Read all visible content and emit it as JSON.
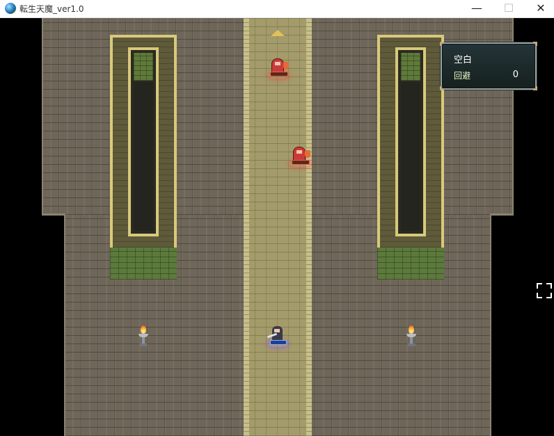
{
  "window": {
    "title": "転生天魔_ver1.0",
    "icon": "globe-icon",
    "controls": {
      "minimize": "—",
      "maximize": "☐",
      "close": "✕"
    }
  },
  "status_window": {
    "name": "空白",
    "evade_label": "回避",
    "evade_value": "0"
  },
  "colors": {
    "floor": "#6e6658",
    "carpet": "#a49b6a",
    "pillar_trim": "#d8c97a",
    "moss": "#5c7a3b",
    "enemy_hp": "#f25a5a",
    "player_hp": "#8ab1ff"
  },
  "icons": {
    "fullscreen": "fullscreen-icon",
    "move_arrow": "arrow-up-icon",
    "brazier": "brazier-icon"
  }
}
